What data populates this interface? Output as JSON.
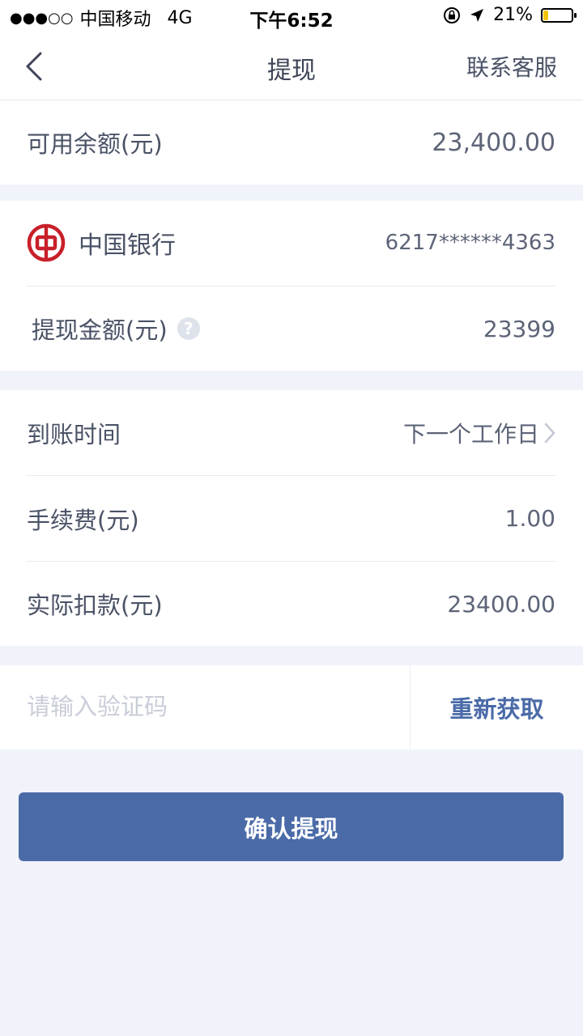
{
  "status_bar": {
    "carrier": "中国移动",
    "network": "4G",
    "time": "下午6:52",
    "battery_percent": "21%",
    "battery_level": 0.21,
    "icons": [
      "orientation-lock-icon",
      "location-arrow-icon",
      "battery-icon"
    ]
  },
  "nav": {
    "title": "提现",
    "service_label": "联系客服",
    "back_icon": "chevron-left-icon"
  },
  "balance": {
    "label": "可用余额(元)",
    "value": "23,400.00"
  },
  "bank": {
    "name": "中国银行",
    "card_number": "6217******4363",
    "logo_color": "#c8202a"
  },
  "withdraw_amount": {
    "label": "提现金额(元)",
    "value": "23399",
    "help_icon": "?"
  },
  "details": {
    "arrival_label": "到账时间",
    "arrival_value": "下一个工作日",
    "fee_label": "手续费(元)",
    "fee_value": "1.00",
    "actual_label": "实际扣款(元)",
    "actual_value": "23400.00"
  },
  "verification": {
    "placeholder": "请输入验证码",
    "value": "",
    "resend_label": "重新获取"
  },
  "confirm_label": "确认提现",
  "colors": {
    "accent": "#4a6aa8",
    "background": "#f0f4fa",
    "text": "#4a5266"
  }
}
